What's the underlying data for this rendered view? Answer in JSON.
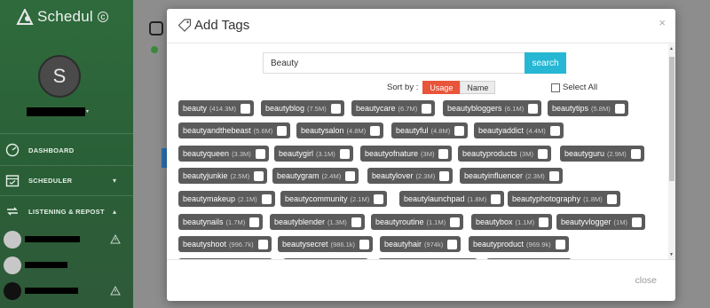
{
  "app": {
    "brand_name": "Schedul",
    "brand_mark": "c"
  },
  "profile": {
    "avatar_letter": "S"
  },
  "sidebar": {
    "items": [
      {
        "label": "DASHBOARD",
        "icon": "dashboard-icon"
      },
      {
        "label": "SCHEDULER",
        "icon": "calendar-icon",
        "chevron": "▾"
      },
      {
        "label": "LISTENING & REPOST",
        "icon": "repost-icon",
        "chevron": "▴"
      }
    ]
  },
  "modal": {
    "title": "Add Tags",
    "close_x": "×",
    "search": {
      "value": "Beauty",
      "button": "search"
    },
    "sort": {
      "label": "Sort by :",
      "options": [
        "Usage",
        "Name"
      ],
      "selected": "Usage"
    },
    "select_all": "Select All",
    "footer_close": "close",
    "tags": [
      {
        "name": "beauty",
        "count": "(414.3M)"
      },
      {
        "name": "beautyblog",
        "count": "(7.5M)"
      },
      {
        "name": "beautycare",
        "count": "(6.7M)"
      },
      {
        "name": "beautybloggers",
        "count": "(6.1M)"
      },
      {
        "name": "beautytips",
        "count": "(5.8M)"
      },
      {
        "name": "beautyandthebeast",
        "count": "(5.6M)"
      },
      {
        "name": "beautysalon",
        "count": "(4.8M)"
      },
      {
        "name": "beautyful",
        "count": "(4.8M)"
      },
      {
        "name": "beautyaddict",
        "count": "(4.4M)"
      },
      {
        "name": "beautyqueen",
        "count": "(3.3M)"
      },
      {
        "name": "beautygirl",
        "count": "(3.1M)"
      },
      {
        "name": "beautyofnature",
        "count": "(3M)"
      },
      {
        "name": "beautyproducts",
        "count": "(3M)"
      },
      {
        "name": "beautyguru",
        "count": "(2.9M)"
      },
      {
        "name": "beautyjunkie",
        "count": "(2.5M)"
      },
      {
        "name": "beautygram",
        "count": "(2.4M)"
      },
      {
        "name": "beautylover",
        "count": "(2.3M)"
      },
      {
        "name": "beautyinfluencer",
        "count": "(2.3M)"
      },
      {
        "name": "beautymakeup",
        "count": "(2.1M)"
      },
      {
        "name": "beautycommunity",
        "count": "(2.1M)"
      },
      {
        "name": "beautylaunchpad",
        "count": "(1.8M)"
      },
      {
        "name": "beautyphotography",
        "count": "(1.8M)"
      },
      {
        "name": "beautynails",
        "count": "(1.7M)"
      },
      {
        "name": "beautyblender",
        "count": "(1.3M)"
      },
      {
        "name": "beautyroutine",
        "count": "(1.1M)"
      },
      {
        "name": "beautybox",
        "count": "(1.1M)"
      },
      {
        "name": "beautyvlogger",
        "count": "(1M)"
      },
      {
        "name": "beautyshoot",
        "count": "(996.7k)"
      },
      {
        "name": "beautysecret",
        "count": "(986.1k)"
      },
      {
        "name": "beautyhair",
        "count": "(974k)"
      },
      {
        "name": "beautyproduct",
        "count": "(969.9k)"
      }
    ]
  },
  "colors": {
    "sidebar": "#2e6b3c",
    "search_button": "#25b7d3",
    "sort_active": "#e8553a",
    "tag_bg": "#5b5b5b"
  }
}
